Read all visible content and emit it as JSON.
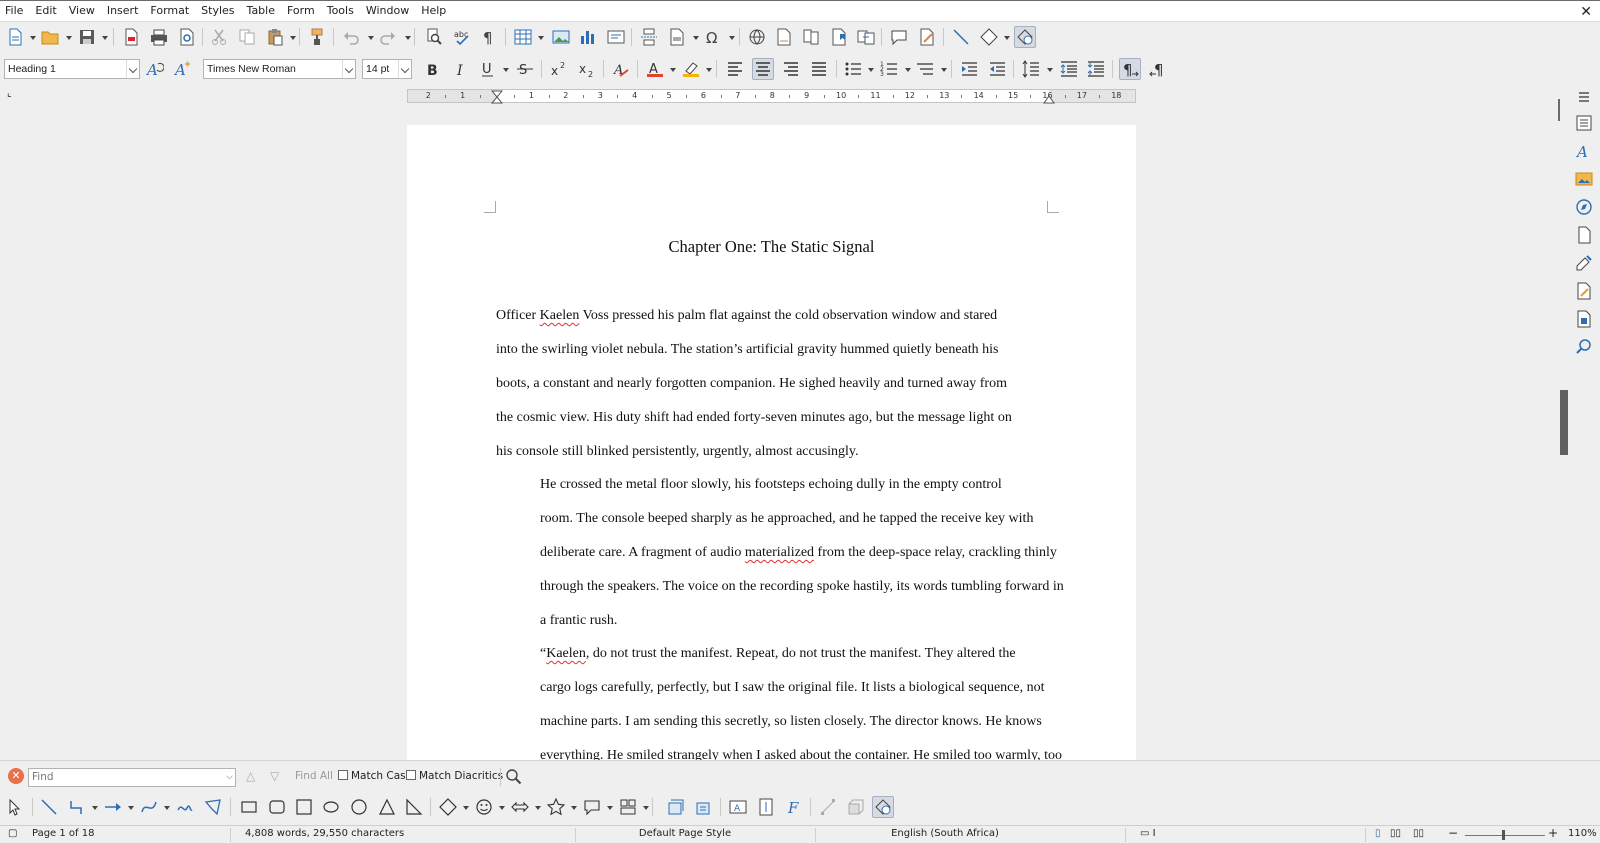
{
  "menu": [
    "File",
    "Edit",
    "View",
    "Insert",
    "Format",
    "Styles",
    "Table",
    "Form",
    "Tools",
    "Window",
    "Help"
  ],
  "formatting": {
    "paragraph_style": "Heading 1",
    "font_name": "Times New Roman",
    "font_size": "14 pt"
  },
  "document": {
    "heading": "Chapter One: The Static Signal",
    "paragraphs": [
      {
        "lines": [
          "Officer Kaelen Voss pressed his palm flat against the cold observation window and stared",
          "into the swirling violet nebula. The station’s artificial gravity hummed quietly beneath his",
          "boots, a constant and nearly forgotten companion. He sighed heavily and turned away from",
          "the cosmic view. His duty shift had ended forty-seven minutes ago, but the message light on",
          "his console still blinked persistently, urgently, almost accusingly."
        ]
      },
      {
        "lines": [
          "He crossed the metal floor slowly, his footsteps echoing dully in the empty control",
          "room. The console beeped sharply as he approached, and he tapped the receive key with",
          "deliberate care. A fragment of audio materialized from the deep-space relay, crackling thinly",
          "through the speakers. The voice on the recording spoke hastily, its words tumbling forward in",
          "a frantic rush."
        ]
      },
      {
        "lines": [
          "“Kaelen, do not trust the manifest. Repeat, do not trust the manifest. They altered the",
          "cargo logs carefully, perfectly, but I saw the original file. It lists a biological sequence, not",
          "machine parts. I am sending this secretly, so listen closely. The director knows. He knows",
          "everything. He smiled strangely when I asked about the container. He smiled too warmly, too"
        ]
      }
    ]
  },
  "findbar": {
    "placeholder": "Find",
    "find_all": "Find All",
    "match_case": "Match Case",
    "match_diacritics": "Match Diacritics"
  },
  "status": {
    "page": "Page 1 of 18",
    "words": "4,808 words, 29,550 characters",
    "page_style": "Default Page Style",
    "language": "English (South Africa)",
    "zoom": "110%"
  },
  "ruler_numbers": [
    "2",
    "1",
    "1",
    "2",
    "3",
    "4",
    "5",
    "6",
    "7",
    "8",
    "9",
    "10",
    "11",
    "12",
    "13",
    "14",
    "15",
    "16",
    "17",
    "18"
  ],
  "colors": {
    "font_color": "#e8412c",
    "highlight": "#f5b400",
    "accent_icon": "#2e6db4"
  }
}
